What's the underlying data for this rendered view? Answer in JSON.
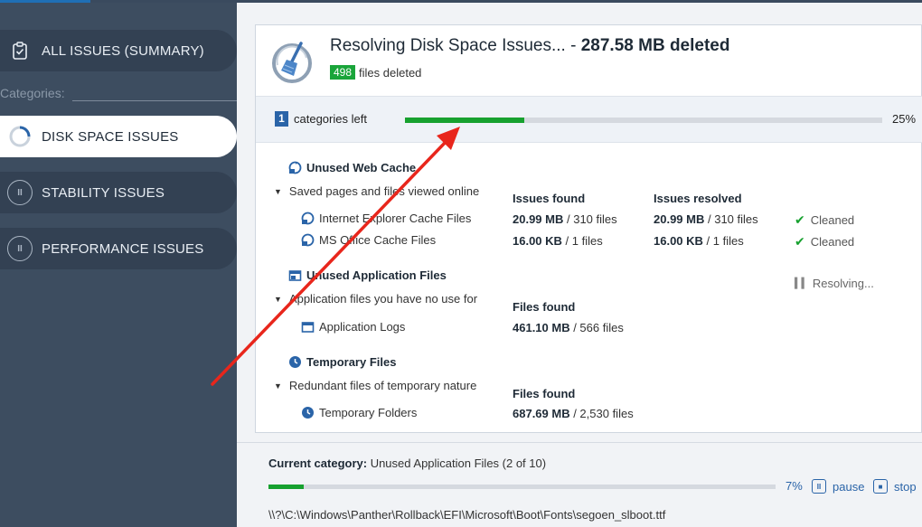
{
  "sidebar": {
    "summary_label": "ALL ISSUES (SUMMARY)",
    "categories_label": "Categories:",
    "items": [
      {
        "label": "DISK SPACE ISSUES",
        "active": true
      },
      {
        "label": "STABILITY ISSUES",
        "active": false
      },
      {
        "label": "PERFORMANCE ISSUES",
        "active": false
      }
    ]
  },
  "header": {
    "title_prefix": "Resolving Disk Space Issues... - ",
    "title_amount": "287.58 MB deleted",
    "files_count": "498",
    "files_label": "files deleted"
  },
  "progress": {
    "categories_left_count": "1",
    "categories_left_label": "categories left",
    "percent_text": "25%",
    "percent_value": 0.25
  },
  "groups": [
    {
      "title": "Unused Web Cache",
      "description": "Saved pages and files viewed online",
      "col1_header": "Issues found",
      "col2_header": "Issues resolved",
      "rows": [
        {
          "name": "Internet Explorer Cache Files",
          "found_size": "20.99 MB",
          "found_count": " / 310 files",
          "resolved_size": "20.99 MB",
          "resolved_count": " / 310 files",
          "status": "Cleaned"
        },
        {
          "name": "MS Office Cache Files",
          "found_size": "16.00 KB",
          "found_count": " / 1 files",
          "resolved_size": "16.00 KB",
          "resolved_count": " / 1 files",
          "status": "Cleaned"
        }
      ]
    },
    {
      "title": "Unused Application Files",
      "description": "Application files you have no use for",
      "col1_header": "Files found",
      "status": "Resolving...",
      "rows": [
        {
          "name": "Application Logs",
          "found_size": "461.10 MB",
          "found_count": " / 566 files"
        }
      ]
    },
    {
      "title": "Temporary Files",
      "description": "Redundant files of temporary nature",
      "col1_header": "Files found",
      "rows": [
        {
          "name": "Temporary Folders",
          "found_size": "687.69 MB",
          "found_count": " / 2,530 files"
        }
      ]
    }
  ],
  "footer": {
    "current_label": "Current category:",
    "current_value": " Unused Application Files (2 of 10)",
    "percent_text": "7%",
    "percent_value": 0.07,
    "pause_label": "pause",
    "stop_label": "stop",
    "file_path": "\\\\?\\C:\\Windows\\Panther\\Rollback\\EFI\\Microsoft\\Boot\\Fonts\\segoen_slboot.ttf"
  },
  "colors": {
    "sidebar_bg": "#3d4d60",
    "accent_green": "#17a12f",
    "accent_blue": "#2a64a8",
    "annotation_red": "#e8261c"
  },
  "icons": {
    "summary": "clipboard-check-icon",
    "disk_space": "spinner-icon",
    "stability": "pause-icon",
    "performance": "pause-icon",
    "logo": "broom-disk-icon",
    "web_cache": "refresh-icon",
    "app_files": "window-icon",
    "temp_files": "clock-icon",
    "cleaned": "check-icon",
    "resolving": "signal-bars-icon"
  }
}
